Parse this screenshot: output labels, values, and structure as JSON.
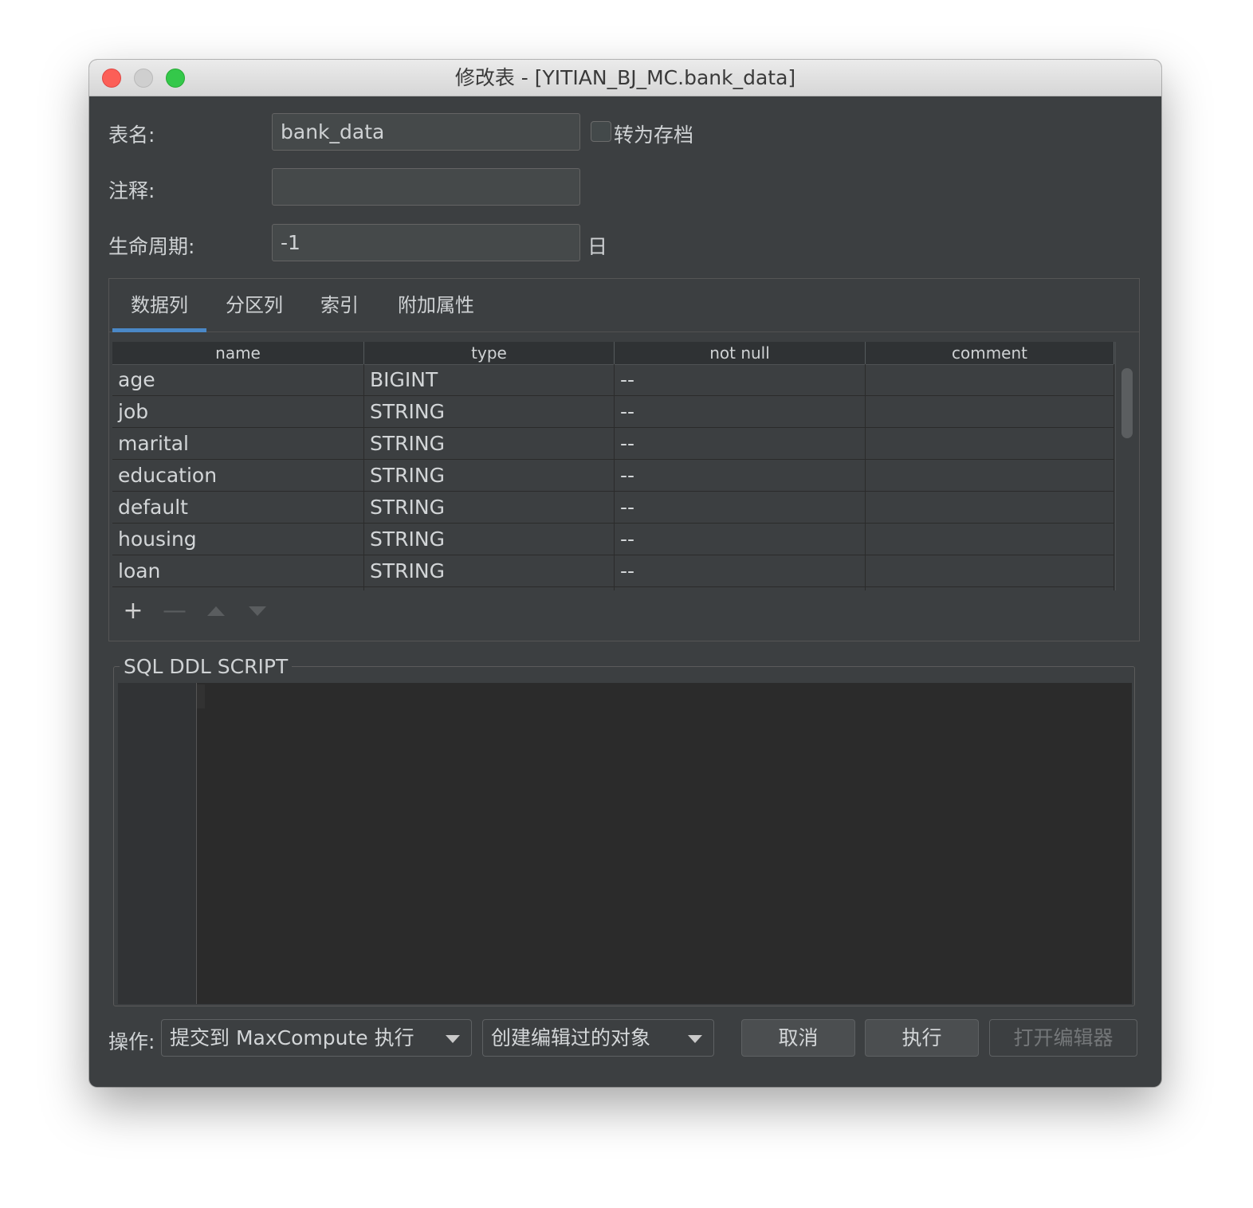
{
  "window": {
    "title": "修改表 - [YITIAN_BJ_MC.bank_data]"
  },
  "form": {
    "table_name_label": "表名:",
    "table_name_value": "bank_data",
    "archive_label": "转为存档",
    "archive_checked": false,
    "comment_label": "注释:",
    "comment_value": "",
    "lifecycle_label": "生命周期:",
    "lifecycle_value": "-1",
    "lifecycle_unit": "日"
  },
  "tabs": [
    {
      "label": "数据列",
      "active": true
    },
    {
      "label": "分区列",
      "active": false
    },
    {
      "label": "索引",
      "active": false
    },
    {
      "label": "附加属性",
      "active": false
    }
  ],
  "table": {
    "headers": [
      "name",
      "type",
      "not null",
      "comment"
    ],
    "rows": [
      [
        "age",
        "BIGINT",
        "--",
        ""
      ],
      [
        "job",
        "STRING",
        "--",
        ""
      ],
      [
        "marital",
        "STRING",
        "--",
        ""
      ],
      [
        "education",
        "STRING",
        "--",
        ""
      ],
      [
        "default",
        "STRING",
        "--",
        ""
      ],
      [
        "housing",
        "STRING",
        "--",
        ""
      ],
      [
        "loan",
        "STRING",
        "--",
        ""
      ]
    ]
  },
  "table_toolbar": {
    "add": "+",
    "remove": "—",
    "move_up_icon": "triangle-up-icon",
    "move_down_icon": "triangle-down-icon"
  },
  "sql": {
    "legend": "SQL DDL SCRIPT",
    "script": ""
  },
  "footer": {
    "operation_label": "操作:",
    "operation_value": "提交到 MaxCompute 执行",
    "mode_value": "创建编辑过的对象",
    "cancel_label": "取消",
    "execute_label": "执行",
    "open_editor_label": "打开编辑器"
  }
}
